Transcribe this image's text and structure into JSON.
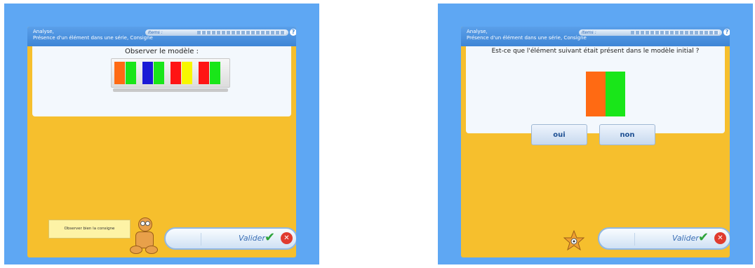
{
  "header": {
    "title_line1": "Analyse,",
    "title_line2": "Présence d'un élément dans une série, Consigne",
    "items_label": "Items :",
    "help_symbol": "?"
  },
  "left_screen": {
    "instruction": "Observer le modèle :",
    "model_groups": [
      [
        "#ff6a13",
        "#19e619"
      ],
      [
        "#1b1bd6",
        "#19e619"
      ],
      [
        "#ff1414",
        "#f7f700"
      ],
      [
        "#ff1414",
        "#19e619"
      ]
    ],
    "hint_text": "Observer bien la consigne",
    "valider_label": "Valider"
  },
  "right_screen": {
    "question": "Est-ce que l'élément suivant était présent dans le modèle initial ?",
    "test_element": [
      "#ff6a13",
      "#19e619"
    ],
    "answer_yes": "oui",
    "answer_no": "non",
    "valider_label": "Valider"
  },
  "colors": {
    "background": "#5ea7f3",
    "app_body": "#f6bf2d",
    "titlebar": "#3f86d6"
  }
}
